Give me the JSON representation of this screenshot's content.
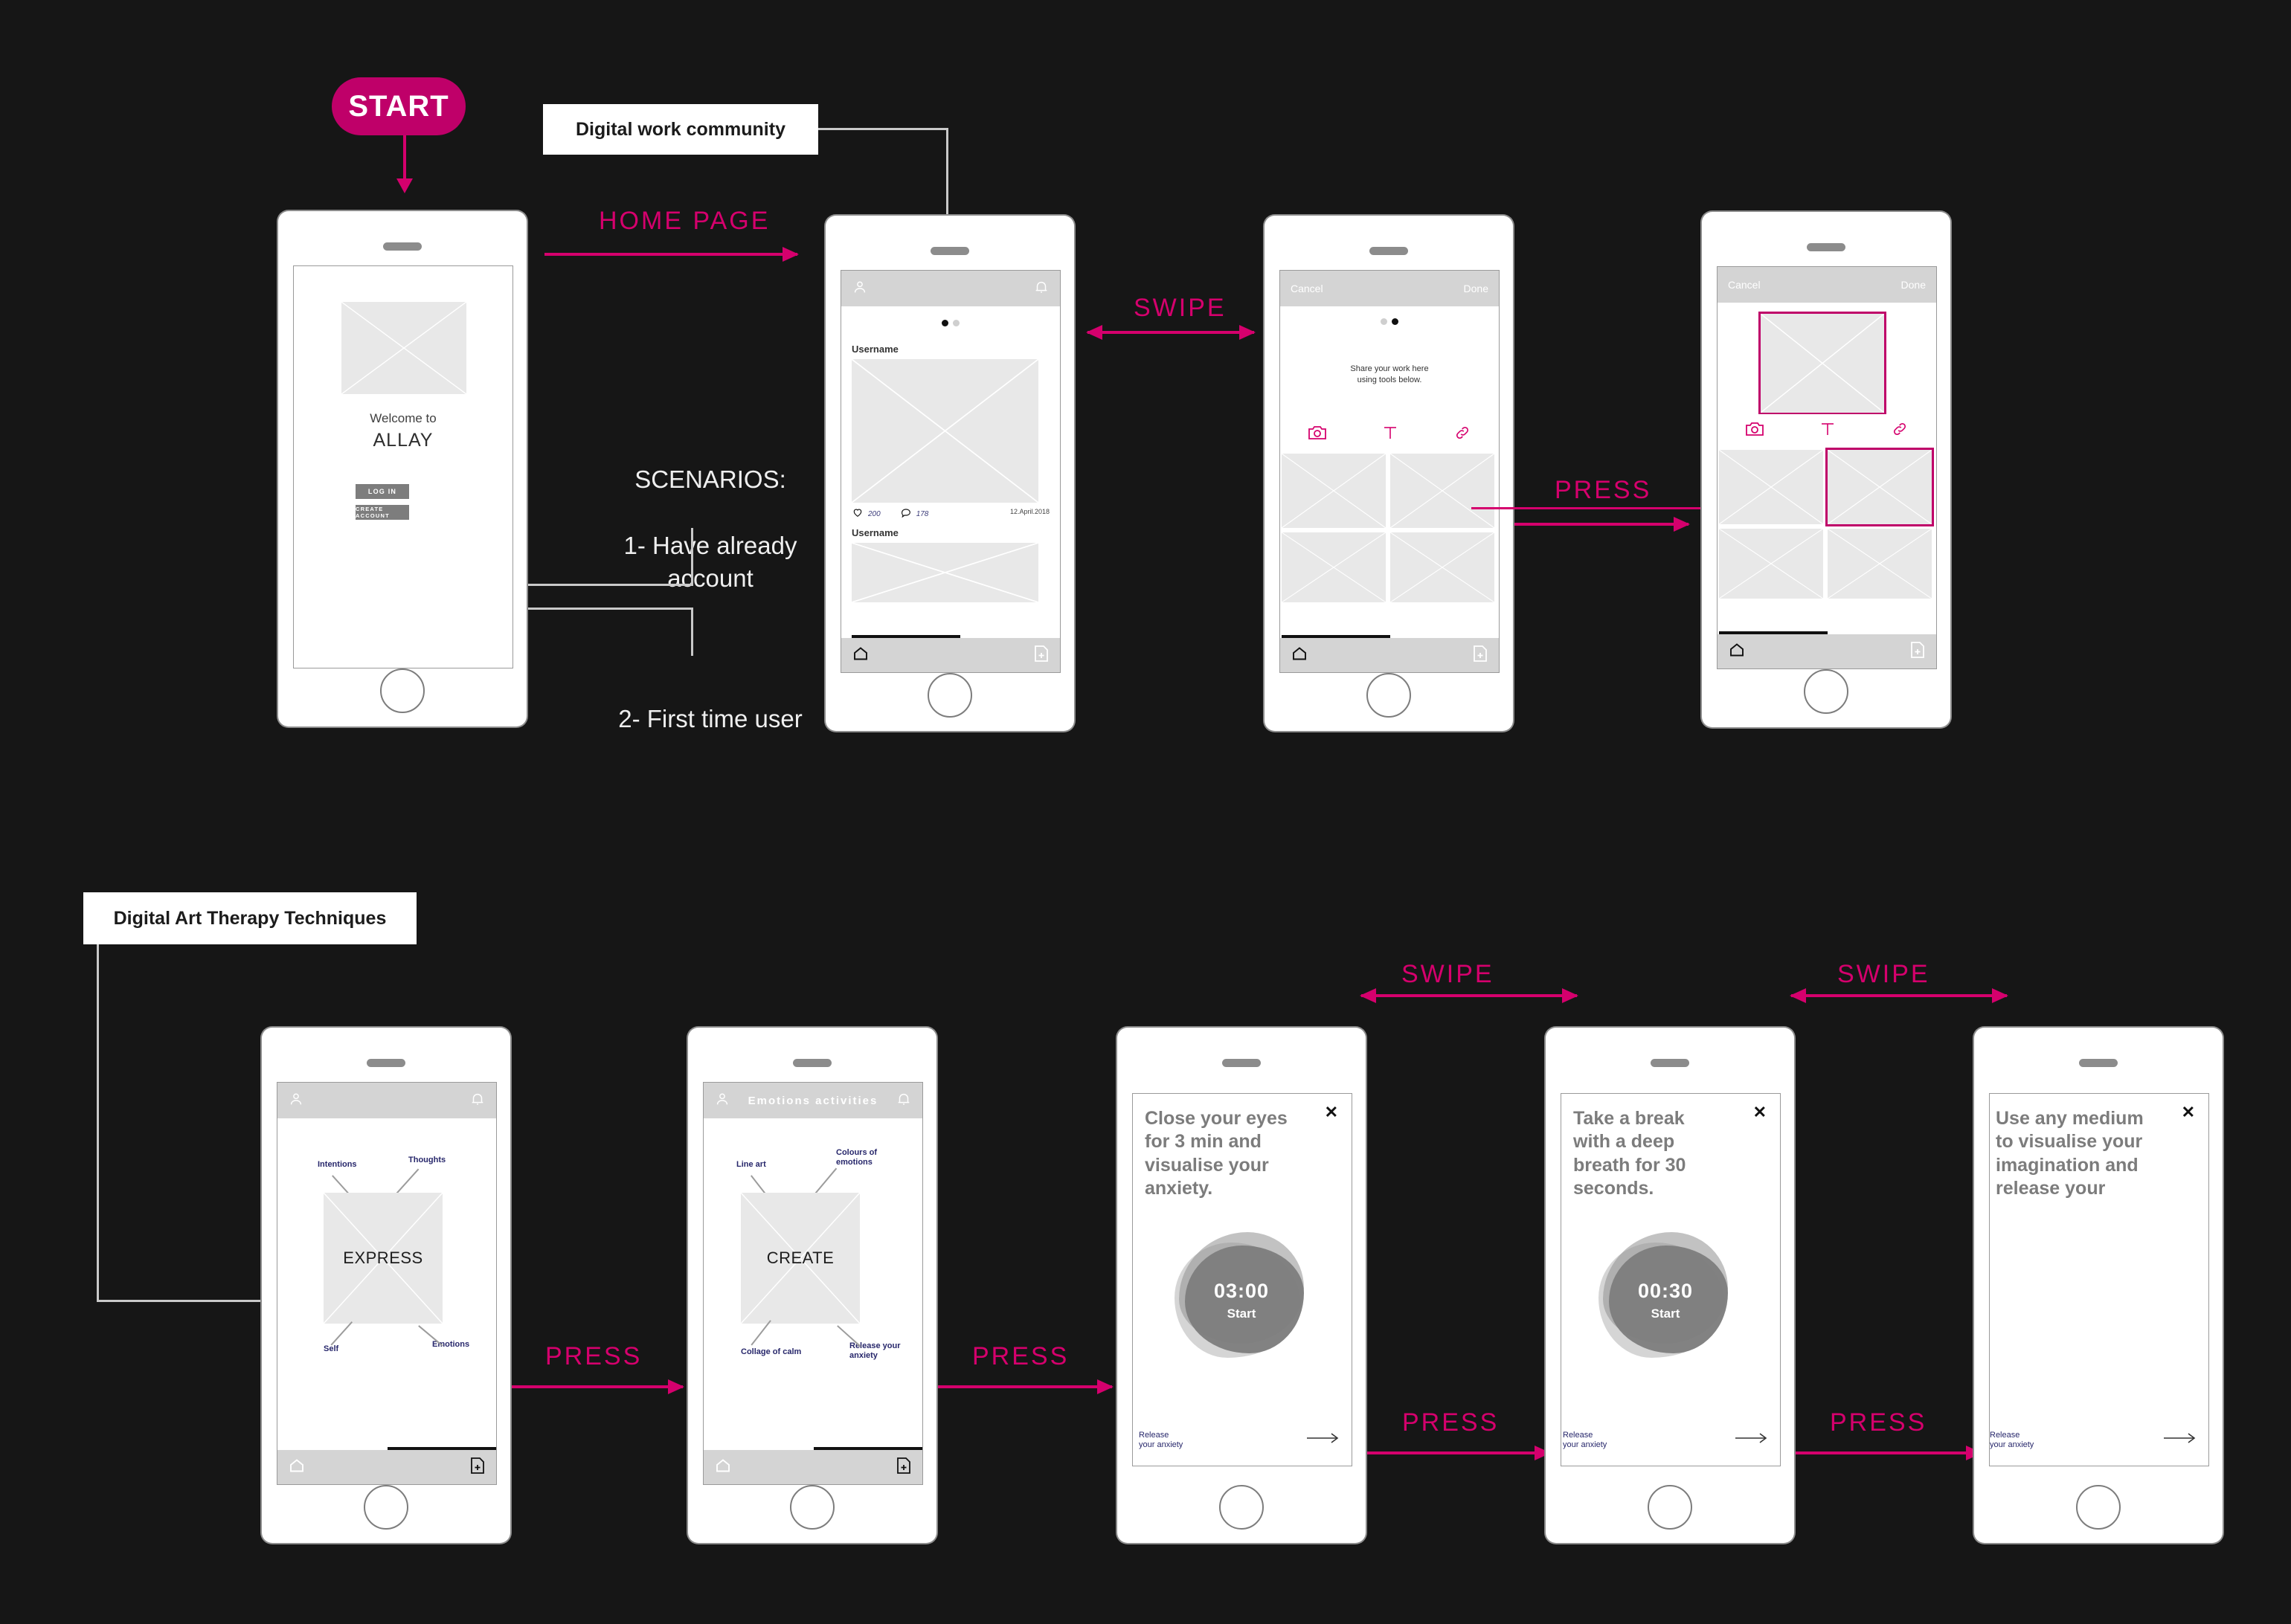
{
  "meta": {
    "accent": "#D5006D",
    "accent_deep": "#BF0069",
    "background": "#161616",
    "callout_color": "#27276b"
  },
  "start_button": {
    "label": "START"
  },
  "section_labels": {
    "row1": "Digital work community",
    "row2": "Digital Art Therapy Techniques"
  },
  "flow_labels": {
    "home_page": "HOME PAGE",
    "swipe_1": "SWIPE",
    "press_1": "PRESS",
    "press_row2_a": "PRESS",
    "press_row2_b": "PRESS",
    "press_row2_c": "PRESS",
    "press_row2_d": "PRESS",
    "swipe_row2_a": "SWIPE",
    "swipe_row2_b": "SWIPE"
  },
  "scenarios": {
    "heading": "SCENARIOS:",
    "item_1": "1- Have already\n     account",
    "item_2": "2- First time user"
  },
  "screens": {
    "welcome": {
      "name": "welcome-screen",
      "welcome_to": "Welcome to",
      "app_name": "ALLAY",
      "login_label": "LOG IN",
      "create_account_label": "CREATE ACCOUNT"
    },
    "feed": {
      "name": "home-feed-screen",
      "profile_icon": "person-icon",
      "bell_icon": "bell-icon",
      "pager_dots": 2,
      "pager_active": 0,
      "post_1": {
        "username": "Username",
        "likes": "200",
        "comments": "178",
        "date": "12.April.2018"
      },
      "post_2": {
        "username": "Username"
      },
      "home_icon": "home-icon",
      "new_post_icon": "new-document-icon"
    },
    "share": {
      "name": "share-work-screen",
      "cancel_label": "Cancel",
      "done_label": "Done",
      "pager_dots": 2,
      "pager_active": 1,
      "hint": "Share your work here\nusing tools below.",
      "tools": [
        "camera-icon",
        "text-icon",
        "link-icon"
      ],
      "gallery_tiles": 4,
      "home_icon": "home-icon",
      "new_post_icon": "new-document-icon"
    },
    "share_selected": {
      "name": "share-work-selected-screen",
      "cancel_label": "Cancel",
      "done_label": "Done",
      "hint": "",
      "tools": [
        "camera-icon",
        "text-icon",
        "link-icon"
      ],
      "gallery_tiles": 4,
      "selected_tile_index": 1,
      "home_icon": "home-icon",
      "new_post_icon": "new-document-icon"
    },
    "express": {
      "name": "express-screen",
      "center_label": "EXPRESS",
      "callouts": {
        "top_left": "Intentions",
        "top_right": "Thoughts",
        "bottom_left": "Self",
        "bottom_right": "Emotions"
      },
      "profile_icon": "person-icon",
      "bell_icon": "bell-icon",
      "home_icon": "home-icon",
      "new_post_icon": "new-document-icon"
    },
    "create": {
      "name": "create-screen",
      "bar_title": "Emotions activities",
      "center_label": "CREATE",
      "callouts": {
        "top_left": "Line art",
        "top_right": "Colours of\nemotions",
        "bottom_left": "Collage of calm",
        "bottom_right": "Release your\nanxiety"
      },
      "profile_icon": "person-icon",
      "bell_icon": "bell-icon",
      "home_icon": "home-icon",
      "new_post_icon": "new-document-icon"
    },
    "timer_3min": {
      "name": "timer-3min-screen",
      "instruction": "Close your eyes for 3 min and visualise your anxiety.",
      "time": "03:00",
      "start_label": "Start",
      "footer": "Release\nyour anxiety",
      "close_icon": "close-icon",
      "next_icon": "arrow-right-icon"
    },
    "timer_30sec": {
      "name": "timer-30sec-screen",
      "instruction": "Take a break with a deep breath for 30 seconds.",
      "time": "00:30",
      "start_label": "Start",
      "footer": "Release\nyour anxiety",
      "close_icon": "close-icon",
      "next_icon": "arrow-right-icon"
    },
    "medium": {
      "name": "any-medium-screen",
      "instruction": "Use any medium to visualise your imagination and release your anxiety, then share it with",
      "footer": "Release\nyour anxiety",
      "close_icon": "close-icon",
      "next_icon": "arrow-right-icon"
    }
  }
}
